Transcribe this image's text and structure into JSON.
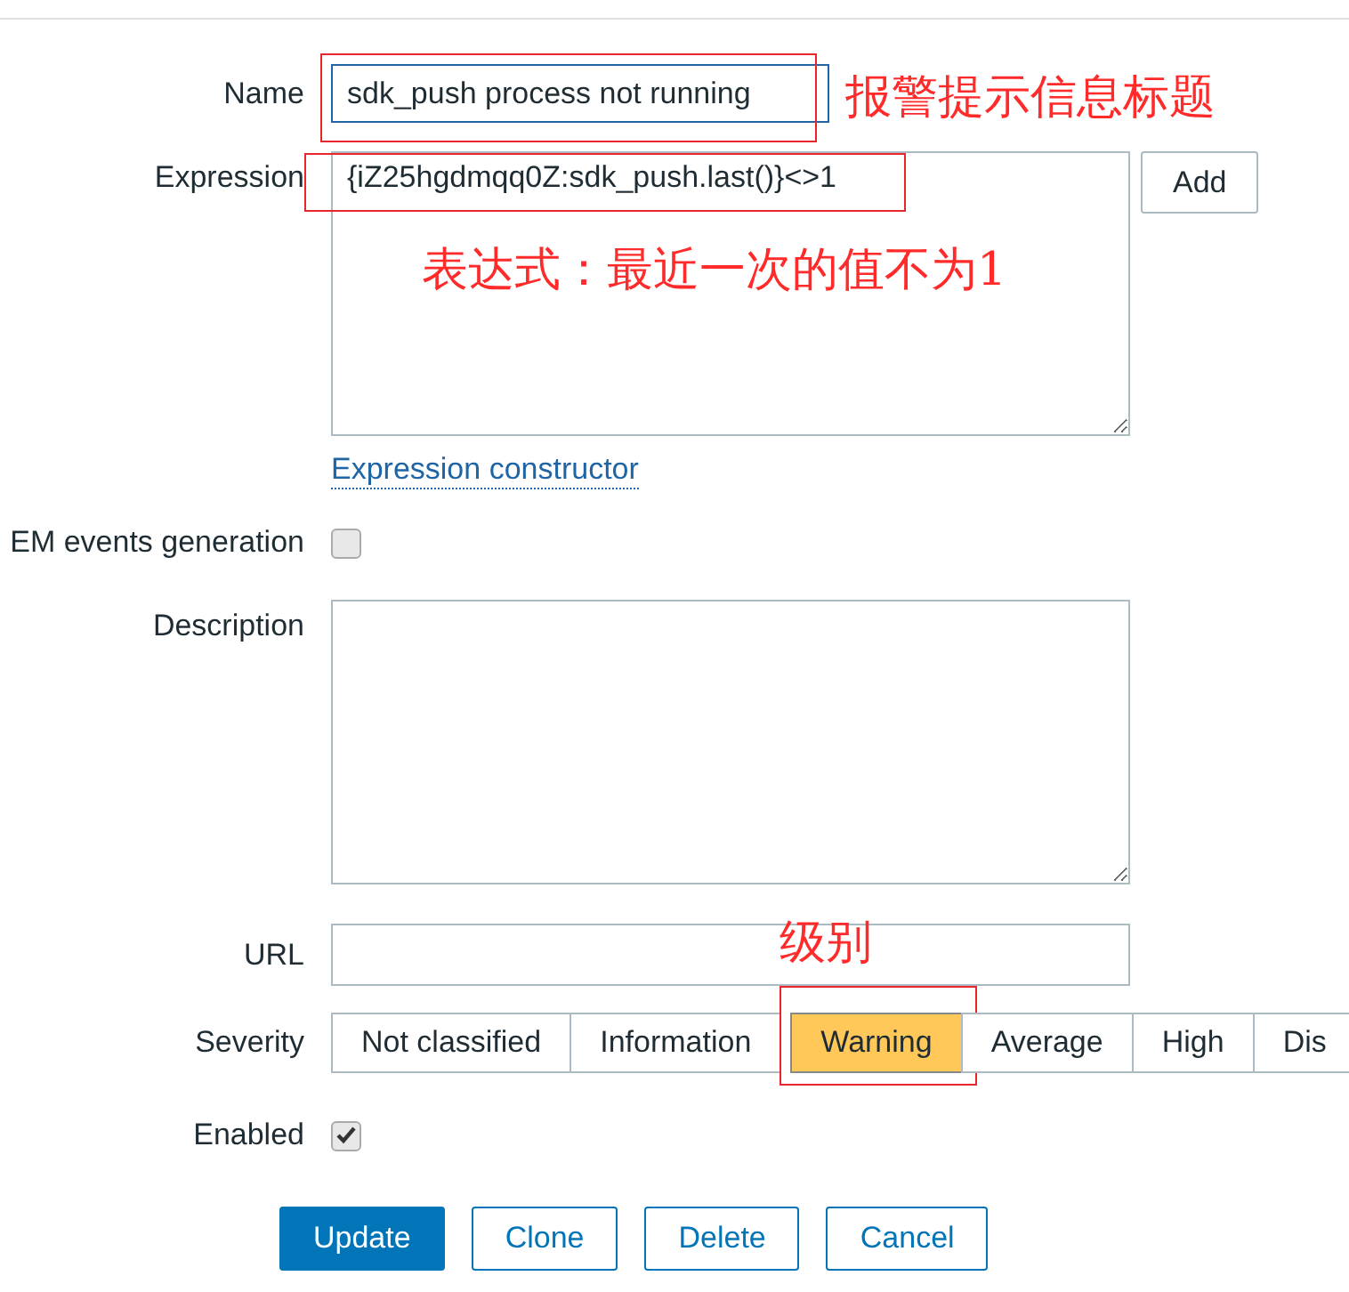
{
  "form": {
    "name": {
      "label": "Name",
      "value": "sdk_push process not running",
      "highlighted": true,
      "note": "报警提示信息标题"
    },
    "expression": {
      "label": "Expression",
      "value": "{iZ25hgdmqq0Z:sdk_push.last()}<>1",
      "highlighted": true,
      "note": "表达式：最近一次的值不为1",
      "add_button": "Add",
      "link": "Expression constructor"
    },
    "events_generation": {
      "label": "EM events generation",
      "checked": false
    },
    "description": {
      "label": "Description"
    },
    "url": {
      "label": "URL"
    },
    "severity": {
      "label": "Severity",
      "note": "级别",
      "options": [
        {
          "label": "Not classified",
          "selected": false,
          "highlighted": false
        },
        {
          "label": "Information",
          "selected": false,
          "highlighted": false
        },
        {
          "label": "Warning",
          "selected": true,
          "highlighted": true
        },
        {
          "label": "Average",
          "selected": false,
          "highlighted": false
        },
        {
          "label": "High",
          "selected": false,
          "highlighted": false
        },
        {
          "label": "Dis",
          "selected": false,
          "highlighted": false
        }
      ]
    },
    "enabled": {
      "label": "Enabled",
      "checked": true
    }
  },
  "buttons": [
    {
      "label": "Update",
      "primary": true
    },
    {
      "label": "Clone",
      "primary": false
    },
    {
      "label": "Delete",
      "primary": false
    },
    {
      "label": "Cancel",
      "primary": false
    }
  ]
}
